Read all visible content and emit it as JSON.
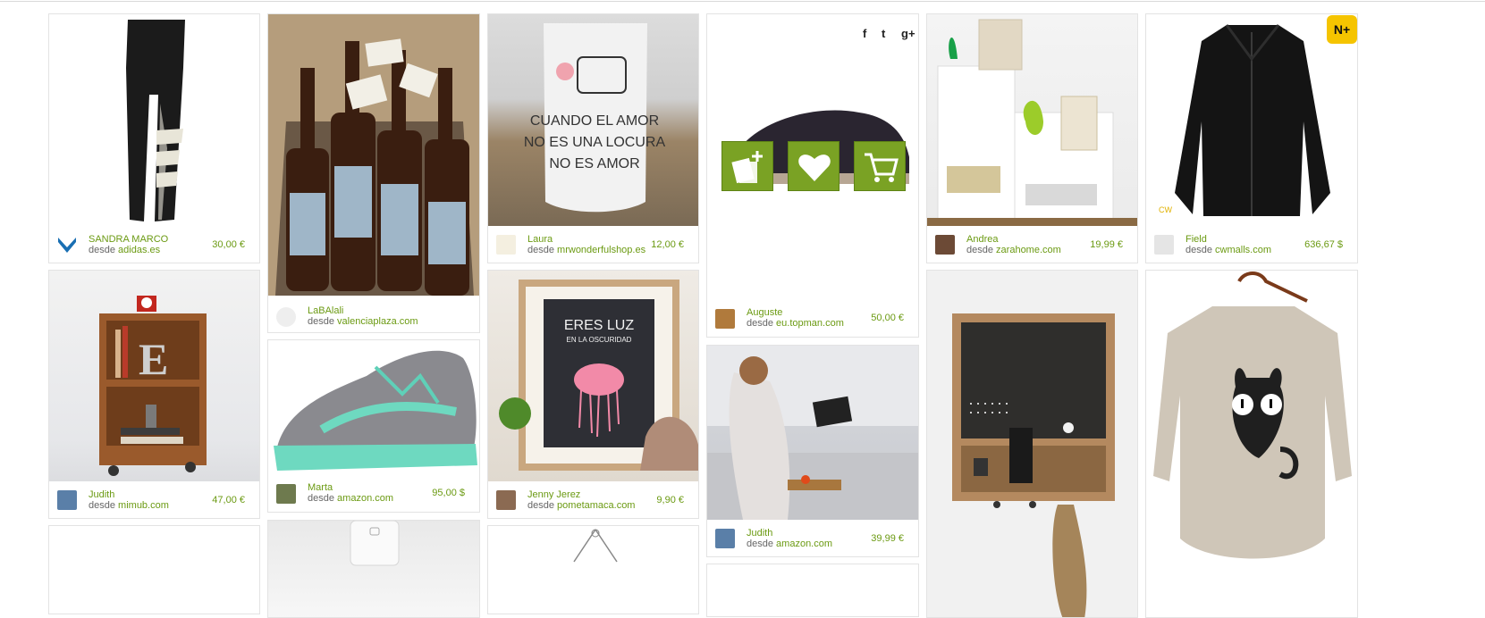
{
  "items": [
    {
      "user": "SANDRA MARCO",
      "from_prefix": "desde",
      "shop": "adidas.es",
      "price": "30,00 €"
    },
    {
      "user": "LaBAlali",
      "from_prefix": "desde",
      "shop": "valenciaplaza.com",
      "price": ""
    },
    {
      "user": "Laura",
      "from_prefix": "desde",
      "shop": "mrwonderfulshop.es",
      "price": "12,00 €",
      "mug_text": [
        "CUANDO EL AMOR",
        "NO ES UNA LOCURA",
        "NO ES AMOR"
      ]
    },
    {
      "user": "Auguste",
      "from_prefix": "desde",
      "shop": "eu.topman.com",
      "price": "50,00 €"
    },
    {
      "user": "Andrea",
      "from_prefix": "desde",
      "shop": "zarahome.com",
      "price": "19,99 €"
    },
    {
      "user": "Field",
      "from_prefix": "desde",
      "shop": "cwmalls.com",
      "price": "636,67 $",
      "badge": "N+",
      "watermark": "CW"
    },
    {
      "user": "Judith",
      "from_prefix": "desde",
      "shop": "mimub.com",
      "price": "47,00 €",
      "crate_letter": "E"
    },
    {
      "user": "Marta",
      "from_prefix": "desde",
      "shop": "amazon.com",
      "price": "95,00 $"
    },
    {
      "user": "Jenny Jerez",
      "from_prefix": "desde",
      "shop": "pometamaca.com",
      "price": "9,90 €",
      "poster_text": [
        "ERES LUZ",
        "EN LA OSCURIDAD"
      ]
    },
    {
      "user": "Judith",
      "from_prefix": "desde",
      "shop": "amazon.com",
      "price": "39,99 €"
    }
  ],
  "social_icons": [
    "facebook-icon",
    "twitter-icon",
    "google-plus-icon"
  ],
  "social_glyphs": [
    "f",
    "t",
    "g+"
  ],
  "action_buttons": [
    "add-to-collection-icon",
    "heart-icon",
    "cart-icon"
  ],
  "colors": {
    "accent": "#6b9a12",
    "action_green": "#7aa224",
    "text_gray": "#666666",
    "border": "#e3e3e3"
  }
}
